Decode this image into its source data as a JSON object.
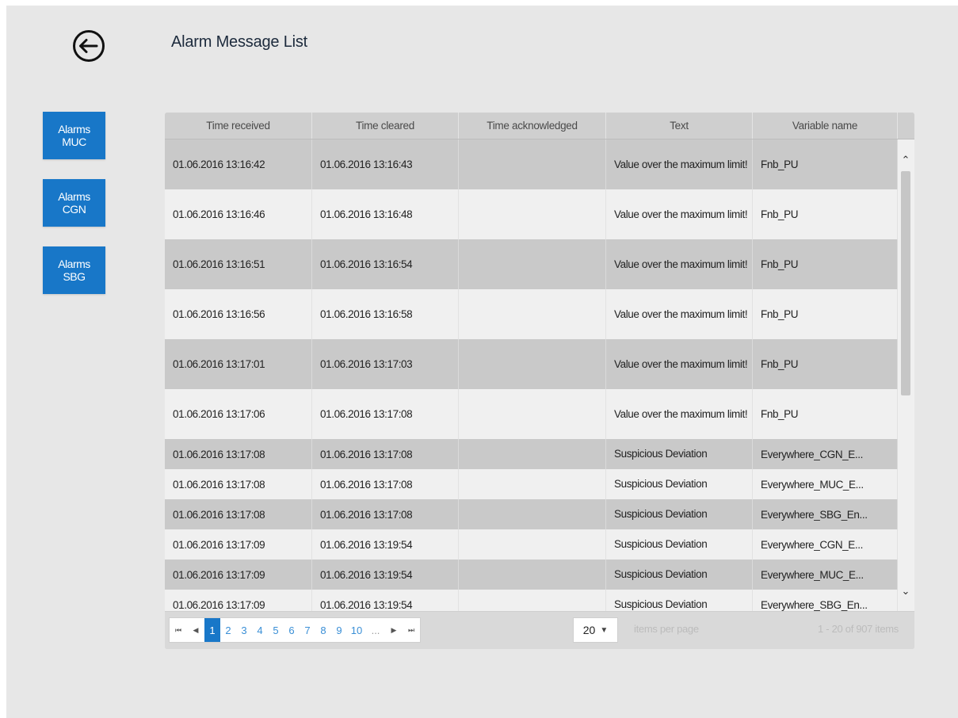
{
  "page": {
    "title": "Alarm Message List"
  },
  "sidebar": {
    "buttons": [
      {
        "label": "Alarms MUC"
      },
      {
        "label": "Alarms CGN"
      },
      {
        "label": "Alarms SBG"
      }
    ]
  },
  "grid": {
    "columns": [
      "Time received",
      "Time cleared",
      "Time acknowledged",
      "Text",
      "Variable name"
    ],
    "rows": [
      {
        "received": "01.06.2016 13:16:42",
        "cleared": "01.06.2016 13:16:43",
        "acknowledged": "",
        "text": "Value over the maximum limit!",
        "variable": "Fnb_PU"
      },
      {
        "received": "01.06.2016 13:16:46",
        "cleared": "01.06.2016 13:16:48",
        "acknowledged": "",
        "text": "Value over the maximum limit!",
        "variable": "Fnb_PU"
      },
      {
        "received": "01.06.2016 13:16:51",
        "cleared": "01.06.2016 13:16:54",
        "acknowledged": "",
        "text": "Value over the maximum limit!",
        "variable": "Fnb_PU"
      },
      {
        "received": "01.06.2016 13:16:56",
        "cleared": "01.06.2016 13:16:58",
        "acknowledged": "",
        "text": "Value over the maximum limit!",
        "variable": "Fnb_PU"
      },
      {
        "received": "01.06.2016 13:17:01",
        "cleared": "01.06.2016 13:17:03",
        "acknowledged": "",
        "text": "Value over the maximum limit!",
        "variable": "Fnb_PU"
      },
      {
        "received": "01.06.2016 13:17:06",
        "cleared": "01.06.2016 13:17:08",
        "acknowledged": "",
        "text": "Value over the maximum limit!",
        "variable": "Fnb_PU"
      },
      {
        "received": "01.06.2016 13:17:08",
        "cleared": "01.06.2016 13:17:08",
        "acknowledged": "",
        "text": "Suspicious Deviation",
        "variable": "Everywhere_CGN_E..."
      },
      {
        "received": "01.06.2016 13:17:08",
        "cleared": "01.06.2016 13:17:08",
        "acknowledged": "",
        "text": "Suspicious Deviation",
        "variable": "Everywhere_MUC_E..."
      },
      {
        "received": "01.06.2016 13:17:08",
        "cleared": "01.06.2016 13:17:08",
        "acknowledged": "",
        "text": "Suspicious Deviation",
        "variable": "Everywhere_SBG_En..."
      },
      {
        "received": "01.06.2016 13:17:09",
        "cleared": "01.06.2016 13:19:54",
        "acknowledged": "",
        "text": "Suspicious Deviation",
        "variable": "Everywhere_CGN_E..."
      },
      {
        "received": "01.06.2016 13:17:09",
        "cleared": "01.06.2016 13:19:54",
        "acknowledged": "",
        "text": "Suspicious Deviation",
        "variable": "Everywhere_MUC_E..."
      },
      {
        "received": "01.06.2016 13:17:09",
        "cleared": "01.06.2016 13:19:54",
        "acknowledged": "",
        "text": "Suspicious Deviation",
        "variable": "Everywhere_SBG_En..."
      }
    ]
  },
  "pager": {
    "pages": [
      "1",
      "2",
      "3",
      "4",
      "5",
      "6",
      "7",
      "8",
      "9",
      "10"
    ],
    "active_page": "1",
    "ellipsis": "...",
    "page_size": "20",
    "per_page_label": "items per page",
    "items_info": "1 - 20 of 907 items"
  },
  "icons": {
    "back": "back-arrow-circle-icon",
    "first": "first-page-icon",
    "prev": "prev-page-icon",
    "next": "next-page-icon",
    "last": "last-page-icon",
    "scroll_up": "chevron-up-icon",
    "scroll_down": "chevron-down-icon",
    "dropdown": "caret-down-icon"
  },
  "colors": {
    "accent": "#1877c8",
    "background": "#e7e7e7",
    "row_alt": "#c9c9c9",
    "row": "#f0f0f0"
  }
}
